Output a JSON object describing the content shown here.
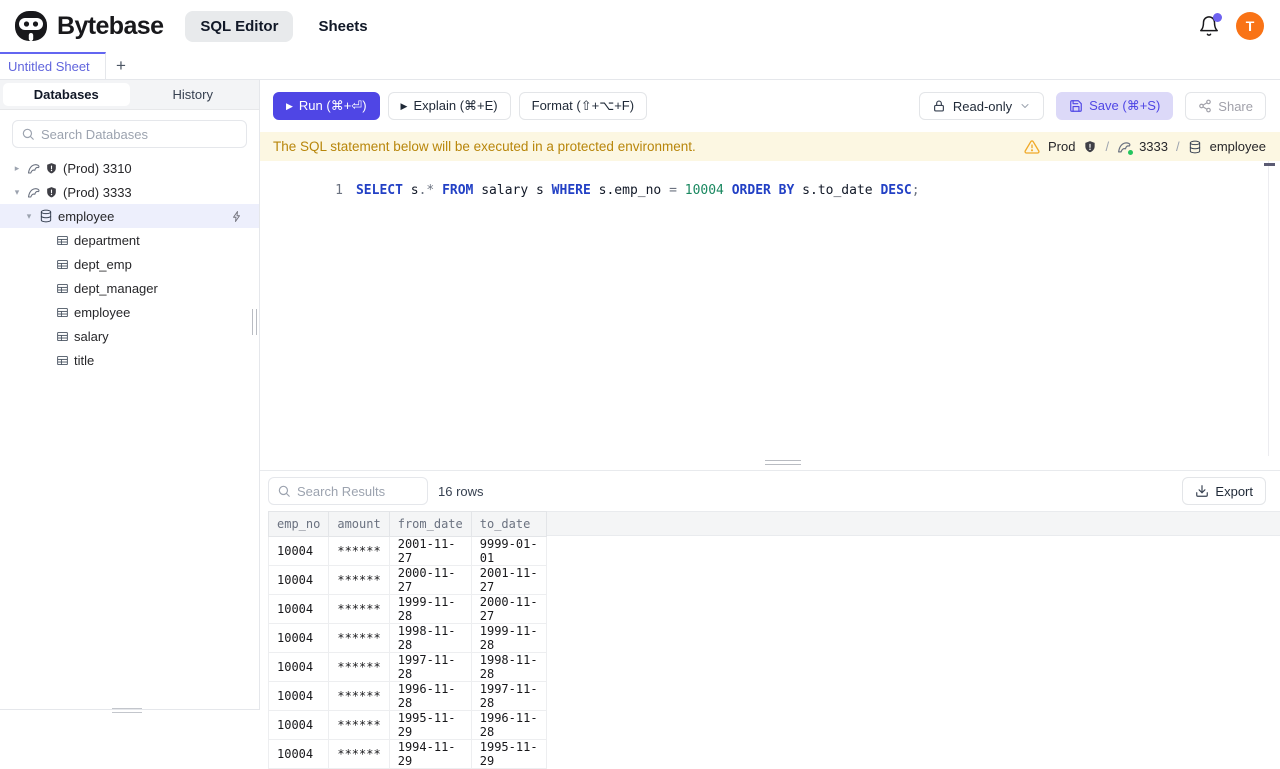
{
  "colors": {
    "accent": "#4f46e5",
    "save_bg": "#dcd9f8",
    "avatar_bg": "#f97316",
    "banner_bg": "#fcf7e2",
    "banner_text": "#b8860b",
    "warning": "#f59e0b",
    "success_dot": "#22c55e",
    "sql_keyword": "#2240c5",
    "sql_number": "#1a8860",
    "tab_accent": "#6366f1"
  },
  "icons": {
    "caret_collapsed": "▸",
    "caret_expanded": "▾",
    "play": "▶",
    "plus": "+"
  },
  "topbar": {
    "brand": "Bytebase",
    "nav_sql_editor": "SQL Editor",
    "nav_sheets": "Sheets",
    "avatar_initial": "T"
  },
  "sheetbar": {
    "tab_label": "Untitled Sheet"
  },
  "sidebar": {
    "tab_databases": "Databases",
    "tab_history": "History",
    "search_placeholder": "Search Databases",
    "instances": [
      {
        "label": "(Prod) 3310"
      },
      {
        "label": "(Prod) 3333"
      }
    ],
    "database_label": "employee",
    "tables": [
      "department",
      "dept_emp",
      "dept_manager",
      "employee",
      "salary",
      "title"
    ]
  },
  "toolbar": {
    "run": "Run (⌘+⏎)",
    "explain": "Explain (⌘+E)",
    "format": "Format (⇧+⌥+F)",
    "readonly": "Read-only",
    "save": "Save (⌘+S)",
    "share": "Share"
  },
  "banner": {
    "message": "The SQL statement below will be executed in a protected environment.",
    "env": "Prod",
    "sep1": "/",
    "instance": "3333",
    "sep2": "/",
    "database": "employee"
  },
  "editor": {
    "line_number": "1",
    "tokens": [
      {
        "t": "SELECT ",
        "c": "kw"
      },
      {
        "t": "s",
        "c": "id"
      },
      {
        "t": ".*",
        "c": "pu"
      },
      {
        "t": " FROM ",
        "c": "kw"
      },
      {
        "t": "salary s ",
        "c": "id"
      },
      {
        "t": "WHERE ",
        "c": "kw"
      },
      {
        "t": "s.emp_no ",
        "c": "id"
      },
      {
        "t": "= ",
        "c": "pu"
      },
      {
        "t": "10004 ",
        "c": "num"
      },
      {
        "t": "ORDER BY ",
        "c": "kw"
      },
      {
        "t": "s.to_date ",
        "c": "id"
      },
      {
        "t": "DESC",
        "c": "kw"
      },
      {
        "t": ";",
        "c": "pu"
      }
    ]
  },
  "results": {
    "search_placeholder": "Search Results",
    "row_count": "16 rows",
    "export": "Export",
    "table": {
      "columns": [
        "emp_no",
        "amount",
        "from_date",
        "to_date"
      ],
      "rows": [
        [
          "10004",
          "******",
          "2001-11-27",
          "9999-01-01"
        ],
        [
          "10004",
          "******",
          "2000-11-27",
          "2001-11-27"
        ],
        [
          "10004",
          "******",
          "1999-11-28",
          "2000-11-27"
        ],
        [
          "10004",
          "******",
          "1998-11-28",
          "1999-11-28"
        ],
        [
          "10004",
          "******",
          "1997-11-28",
          "1998-11-28"
        ],
        [
          "10004",
          "******",
          "1996-11-28",
          "1997-11-28"
        ],
        [
          "10004",
          "******",
          "1995-11-29",
          "1996-11-28"
        ],
        [
          "10004",
          "******",
          "1994-11-29",
          "1995-11-29"
        ]
      ]
    }
  }
}
